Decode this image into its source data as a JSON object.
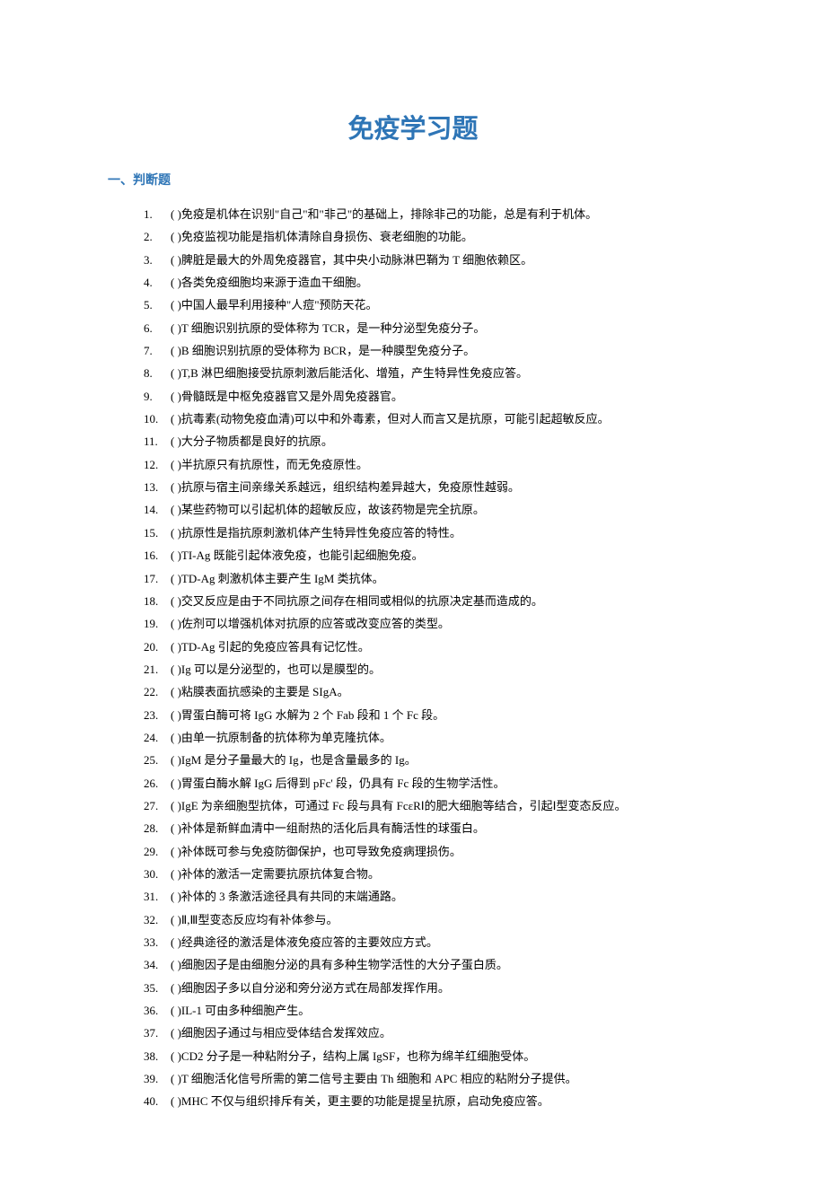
{
  "title": "免疫学习题",
  "section_header": "一、判断题",
  "questions": [
    {
      "num": "1.",
      "text": "(  )免疫是机体在识别\"自己\"和\"非己\"的基础上，排除非己的功能，总是有利于机体。"
    },
    {
      "num": "2.",
      "text": "(  )免疫监视功能是指机体清除自身损伤、衰老细胞的功能。"
    },
    {
      "num": "3.",
      "text": "(  )脾脏是最大的外周免疫器官，其中央小动脉淋巴鞘为 T 细胞依赖区。"
    },
    {
      "num": "4.",
      "text": "(  )各类免疫细胞均来源于造血干细胞。"
    },
    {
      "num": "5.",
      "text": "(  )中国人最早利用接种\"人痘\"预防天花。"
    },
    {
      "num": "6.",
      "text": "(  )T 细胞识别抗原的受体称为 TCR，是一种分泌型免疫分子。"
    },
    {
      "num": "7.",
      "text": "(  )B 细胞识别抗原的受体称为 BCR，是一种膜型免疫分子。"
    },
    {
      "num": "8.",
      "text": "(  )T,B 淋巴细胞接受抗原刺激后能活化、增殖，产生特异性免疫应答。"
    },
    {
      "num": "9.",
      "text": "(  )骨髓既是中枢免疫器官又是外周免疫器官。"
    },
    {
      "num": "10.",
      "text": "(  )抗毒素(动物免疫血清)可以中和外毒素，但对人而言又是抗原，可能引起超敏反应。"
    },
    {
      "num": "11.",
      "text": "(  )大分子物质都是良好的抗原。"
    },
    {
      "num": "12.",
      "text": "(  )半抗原只有抗原性，而无免疫原性。"
    },
    {
      "num": "13.",
      "text": "(  )抗原与宿主间亲缘关系越远，组织结构差异越大，免疫原性越弱。"
    },
    {
      "num": "14.",
      "text": "(  )某些药物可以引起机体的超敏反应，故该药物是完全抗原。"
    },
    {
      "num": "15.",
      "text": "(  )抗原性是指抗原刺激机体产生特异性免疫应答的特性。"
    },
    {
      "num": "16.",
      "text": "(  )TI-Ag 既能引起体液免疫，也能引起细胞免疫。"
    },
    {
      "num": "17.",
      "text": "(  )TD-Ag 刺激机体主要产生 IgM 类抗体。"
    },
    {
      "num": "18.",
      "text": "(  )交叉反应是由于不同抗原之间存在相同或相似的抗原决定基而造成的。"
    },
    {
      "num": "19.",
      "text": "(  )佐剂可以增强机体对抗原的应答或改变应答的类型。"
    },
    {
      "num": "20.",
      "text": "(  )TD-Ag 引起的免疫应答具有记忆性。"
    },
    {
      "num": "21.",
      "text": "(  )Ig 可以是分泌型的，也可以是膜型的。"
    },
    {
      "num": "22.",
      "text": "(  )粘膜表面抗感染的主要是 SIgA。"
    },
    {
      "num": "23.",
      "text": "(  )胃蛋白酶可将 IgG 水解为 2 个 Fab 段和 1 个 Fc 段。"
    },
    {
      "num": "24.",
      "text": "(  )由单一抗原制备的抗体称为单克隆抗体。"
    },
    {
      "num": "25.",
      "text": "(  )IgM 是分子量最大的 Ig，也是含量最多的 Ig。"
    },
    {
      "num": "26.",
      "text": "(  )胃蛋白酶水解 IgG 后得到 pFc' 段，仍具有 Fc 段的生物学活性。"
    },
    {
      "num": "27.",
      "text": "(  )IgE 为亲细胞型抗体，可通过 Fc 段与具有 FcεRⅠ的肥大细胞等结合，引起Ⅰ型变态反应。"
    },
    {
      "num": "28.",
      "text": "(  )补体是新鲜血清中一组耐热的活化后具有酶活性的球蛋白。"
    },
    {
      "num": "29.",
      "text": "(  )补体既可参与免疫防御保护，也可导致免疫病理损伤。"
    },
    {
      "num": "30.",
      "text": "(  )补体的激活一定需要抗原抗体复合物。"
    },
    {
      "num": "31.",
      "text": "(  )补体的 3 条激活途径具有共同的末端通路。"
    },
    {
      "num": "32.",
      "text": "(  )Ⅱ,Ⅲ型变态反应均有补体参与。"
    },
    {
      "num": "33.",
      "text": "(  )经典途径的激活是体液免疫应答的主要效应方式。"
    },
    {
      "num": "34.",
      "text": "(  )细胞因子是由细胞分泌的具有多种生物学活性的大分子蛋白质。"
    },
    {
      "num": "35.",
      "text": "(  )细胞因子多以自分泌和旁分泌方式在局部发挥作用。"
    },
    {
      "num": "36.",
      "text": "(  )IL-1 可由多种细胞产生。"
    },
    {
      "num": "37.",
      "text": "(  )细胞因子通过与相应受体结合发挥效应。"
    },
    {
      "num": "38.",
      "text": "(  )CD2 分子是一种粘附分子，结构上属 IgSF，也称为绵羊红细胞受体。"
    },
    {
      "num": "39.",
      "text": "(  )T 细胞活化信号所需的第二信号主要由 Th 细胞和 APC 相应的粘附分子提供。"
    },
    {
      "num": "40.",
      "text": "(  )MHC 不仅与组织排斥有关，更主要的功能是提呈抗原，启动免疫应答。"
    }
  ]
}
